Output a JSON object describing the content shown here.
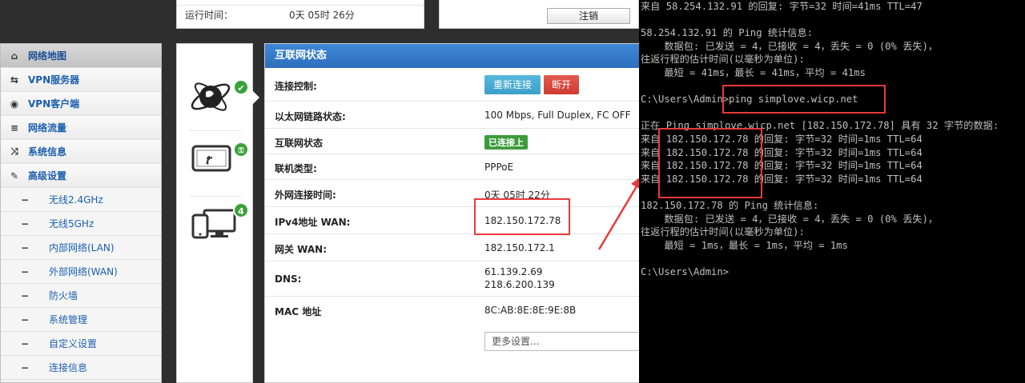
{
  "top_panel": {
    "uptime_label": "运行时间：",
    "uptime_value": "0天 05时 26分",
    "logout_label": "注销"
  },
  "sidebar": {
    "items": [
      {
        "icon": "home-icon",
        "glyph": "⌂",
        "label": "网络地图",
        "active": true
      },
      {
        "icon": "vpn-server-icon",
        "glyph": "⇆",
        "label": "VPN服务器"
      },
      {
        "icon": "vpn-client-icon",
        "glyph": "◉",
        "label": "VPN客户端"
      },
      {
        "icon": "traffic-icon",
        "glyph": "≡",
        "label": "网络流量"
      },
      {
        "icon": "shuffle-icon",
        "glyph": "⤨",
        "label": "系统信息"
      },
      {
        "icon": "wrench-icon",
        "glyph": "✎",
        "label": "高级设置"
      }
    ],
    "sub_items": [
      {
        "label": "无线2.4GHz"
      },
      {
        "label": "无线5GHz"
      },
      {
        "label": "内部网络(LAN)"
      },
      {
        "label": "外部网络(WAN)"
      },
      {
        "label": "防火墙"
      },
      {
        "label": "系统管理"
      },
      {
        "label": "自定义设置"
      },
      {
        "label": "连接信息"
      }
    ]
  },
  "icon_column": {
    "internet_badge": "✔",
    "wireless_badge": "🔒",
    "clients_badge": "4"
  },
  "main_panel": {
    "title": "互联网状态",
    "conn_control_label": "连接控制:",
    "reconnect_label": "重新连接",
    "disconnect_label": "断开",
    "ethernet_label": "以太网链路状态:",
    "ethernet_value": "100 Mbps, Full Duplex, FC OFF",
    "inet_status_label": "互联网状态",
    "inet_status_value": "已连接上",
    "conn_type_label": "联机类型:",
    "conn_type_value": "PPPoE",
    "wan_uptime_label": "外网连接时间:",
    "wan_uptime_value": "0天 05时 22分",
    "ipv4_label": "IPv4地址 WAN:",
    "ipv4_value": "182.150.172.78",
    "gateway_label": "网关 WAN:",
    "gateway_value": "182.150.172.1",
    "dns_label": "DNS:",
    "dns_value_1": "61.139.2.69",
    "dns_value_2": "218.6.200.139",
    "mac_label": "MAC 地址",
    "mac_value": "8C:AB:8E:8E:9E:8B",
    "more_settings": "更多设置..."
  },
  "console": {
    "lines": [
      "来自 58.254.132.91 的回复: 字节=32 时间=41ms TTL=47",
      "",
      "58.254.132.91 的 Ping 统计信息:",
      "    数据包: 已发送 = 4，已接收 = 4，丢失 = 0 (0% 丢失)，",
      "往返行程的估计时间(以毫秒为单位):",
      "    最短 = 41ms，最长 = 41ms，平均 = 41ms",
      "",
      "C:\\Users\\Admin>ping simplove.wicp.net",
      "",
      "正在 Ping simplove.wicp.net [182.150.172.78] 具有 32 字节的数据:",
      "来自 182.150.172.78 的回复: 字节=32 时间=1ms TTL=64",
      "来自 182.150.172.78 的回复: 字节=32 时间=1ms TTL=64",
      "来自 182.150.172.78 的回复: 字节=32 时间=1ms TTL=64",
      "来自 182.150.172.78 的回复: 字节=32 时间=1ms TTL=64",
      "",
      "182.150.172.78 的 Ping 统计信息:",
      "    数据包: 已发送 = 4，已接收 = 4，丢失 = 0 (0% 丢失)，",
      "往返行程的估计时间(以毫秒为单位):",
      "    最短 = 1ms，最长 = 1ms，平均 = 1ms",
      "",
      "C:\\Users\\Admin>"
    ]
  },
  "colors": {
    "accent_blue": "#2c6fbd",
    "highlight_red": "#e83a3a",
    "status_green": "#3c9b3c"
  }
}
